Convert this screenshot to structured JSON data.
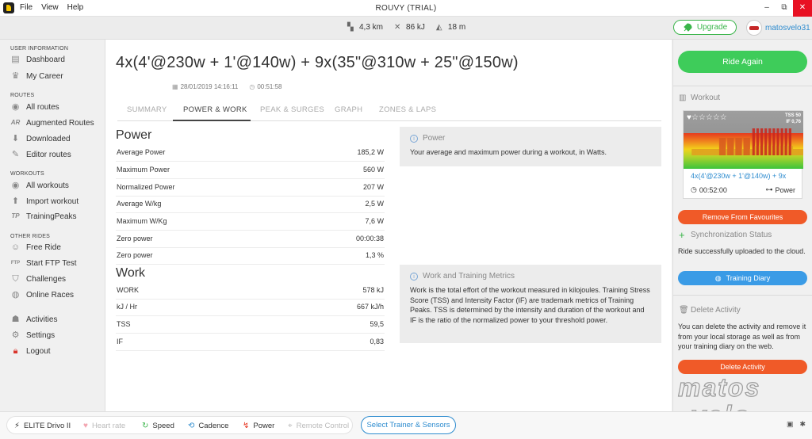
{
  "window": {
    "title": "ROUVY (TRIAL)",
    "menu": [
      "File",
      "View",
      "Help"
    ],
    "controls": {
      "minimize": "–",
      "maximize": "⧉",
      "close": "✕"
    }
  },
  "topbar": {
    "distance": "4,3 km",
    "energy": "86 kJ",
    "elevation": "18 m",
    "upgrade_label": "Upgrade",
    "username": "matosvelo31"
  },
  "sidebar": {
    "sections": [
      {
        "label": "USER INFORMATION",
        "items": [
          {
            "label": "Dashboard",
            "icon": "dashboard-icon"
          },
          {
            "label": "My Career",
            "icon": "trophy-icon"
          }
        ]
      },
      {
        "label": "ROUTES",
        "items": [
          {
            "label": "All routes",
            "icon": "eye-icon"
          },
          {
            "label": "Augmented Routes",
            "icon": "ar-icon"
          },
          {
            "label": "Downloaded",
            "icon": "download-icon"
          },
          {
            "label": "Editor routes",
            "icon": "pencil-icon"
          }
        ]
      },
      {
        "label": "WORKOUTS",
        "items": [
          {
            "label": "All workouts",
            "icon": "eye-icon"
          },
          {
            "label": "Import workout",
            "icon": "upload-icon"
          },
          {
            "label": "TrainingPeaks",
            "icon": "trainingpeaks-icon"
          }
        ]
      },
      {
        "label": "OTHER RIDES",
        "items": [
          {
            "label": "Free Ride",
            "icon": "smile-icon"
          },
          {
            "label": "Start FTP Test",
            "icon": "ftp-icon"
          },
          {
            "label": "Challenges",
            "icon": "shield-icon"
          },
          {
            "label": "Online Races",
            "icon": "globe-icon"
          }
        ]
      }
    ],
    "bottom": [
      {
        "label": "Activities",
        "icon": "people-icon"
      },
      {
        "label": "Settings",
        "icon": "gear-icon"
      },
      {
        "label": "Logout",
        "icon": "lock-icon"
      }
    ],
    "ar_glyph": "AR",
    "tp_glyph": "TP",
    "ftp_glyph": "FTP"
  },
  "workout": {
    "title": "4x(4'@230w + 1'@140w) + 9x(35\"@310w + 25\"@150w)",
    "date": "28/01/2019 14:16:11",
    "duration": "00:51:58"
  },
  "tabs": [
    "SUMMARY",
    "POWER & WORK",
    "PEAK & SURGES",
    "GRAPH",
    "ZONES & LAPS"
  ],
  "power": {
    "heading": "Power",
    "rows": [
      {
        "label": "Average Power",
        "value": "185,2 W"
      },
      {
        "label": "Maximum Power",
        "value": "560 W"
      },
      {
        "label": "Normalized Power",
        "value": "207 W"
      },
      {
        "label": "Average W/kg",
        "value": "2,5 W"
      },
      {
        "label": "Maximum W/Kg",
        "value": "7,6 W"
      },
      {
        "label": "Zero power",
        "value": "00:00:38"
      },
      {
        "label": "Zero power",
        "value": "1,3 %"
      }
    ],
    "info_title": "Power",
    "info_text": "Your average and maximum power during a workout, in Watts."
  },
  "work": {
    "heading": "Work",
    "rows": [
      {
        "label": "WORK",
        "value": "578 kJ"
      },
      {
        "label": "kJ / Hr",
        "value": "667 kJ/h"
      },
      {
        "label": "TSS",
        "value": "59,5"
      },
      {
        "label": "IF",
        "value": "0,83"
      }
    ],
    "info_title": "Work and Training Metrics",
    "info_text": "Work is the total effort of the workout measured in kilojoules. Training Stress Score (TSS) and Intensity Factor (IF) are trademark metrics of Training Peaks. TSS is determined by the intensity and duration of the workout and IF is the ratio of the normalized power to your threshold power."
  },
  "rpanel": {
    "ride_again": "Ride Again",
    "workout_heading": "Workout",
    "card": {
      "tss": "TSS 50",
      "if": "IF 0,76",
      "link": "4x(4'@230w + 1'@140w) + 9x",
      "duration": "00:52:00",
      "type": "Power",
      "stars_glyph": "♥☆☆☆☆☆",
      "profile": [
        0,
        0,
        0,
        0,
        0,
        0,
        0,
        0,
        0,
        0,
        0.2,
        0.2,
        0.2,
        0.2,
        0.2,
        0.2,
        0.2,
        0.2,
        0.2,
        0.2,
        0.2,
        0.2,
        0.2,
        0.2,
        0.2,
        0.2,
        0.2,
        0.2,
        0.2,
        0.2,
        0.2,
        0.2,
        0.2,
        0.2,
        0.2,
        0.2,
        0.2,
        0.2,
        0.2,
        0.2,
        0.2,
        0.2,
        0.2,
        0.2,
        0.55,
        0.55,
        0.55,
        0.55,
        0.55,
        0.55,
        0.55,
        0.55,
        0.2,
        0.2,
        0.55,
        0.55,
        0.55,
        0.55,
        0.55,
        0.55,
        0.55,
        0.55,
        0.2,
        0.2,
        0.55,
        0.55,
        0.55,
        0.55,
        0.55,
        0.55,
        0.55,
        0.55,
        0.2,
        0.2,
        0.55,
        0.55,
        0.55,
        0.55,
        0.55,
        0.55,
        0.55,
        0.55,
        0.2,
        0.2,
        0.2,
        0.85,
        0.85,
        0.85,
        0.3,
        0.3,
        0.85,
        0.85,
        0.85,
        0.3,
        0.3,
        0.85,
        0.85,
        0.85,
        0.3,
        0.3,
        0.85,
        0.85,
        0.85,
        0.3,
        0.3,
        0.85,
        0.85,
        0.85,
        0.3,
        0.3,
        0.85,
        0.85,
        0.85,
        0.3,
        0.3,
        0.85,
        0.85,
        0.85,
        0.3,
        0.3,
        0.85,
        0.85,
        0.85,
        0.3,
        0.3,
        0.85,
        0.85,
        0.85,
        0.3,
        0.3,
        0.85,
        0.85,
        0.85,
        0.3,
        0.3,
        0.2,
        0.2,
        0.2,
        0.2,
        0.2,
        0.2,
        0.2,
        0.2,
        0.2,
        0.2,
        0.2,
        0.2,
        0.2
      ]
    },
    "remove_fav": "Remove From Favourites",
    "sync_heading": "Synchronization Status",
    "sync_text": "Ride successfully uploaded to the cloud.",
    "training_diary": "Training Diary",
    "delete_heading": "Delete Activity",
    "delete_text": "You can delete the activity and remove it from your local storage as well as from your training diary on the web.",
    "delete_btn": "Delete Activity"
  },
  "watermark": {
    "text": "matos velo"
  },
  "statusbar": {
    "items": [
      {
        "label": "ELITE Drivo II",
        "icon": "trainer-icon",
        "active": true
      },
      {
        "label": "Heart rate",
        "icon": "heart-icon",
        "active": false
      },
      {
        "label": "Speed",
        "icon": "speed-icon",
        "active": true
      },
      {
        "label": "Cadence",
        "icon": "cadence-icon",
        "active": true
      },
      {
        "label": "Power",
        "icon": "power-icon",
        "active": true
      },
      {
        "label": "Remote Control",
        "icon": "remote-icon",
        "active": false
      }
    ],
    "select_btn": "Select Trainer & Sensors"
  },
  "colors": {
    "accent_blue": "#2e8ccf",
    "green": "#3ecc5a",
    "orange": "#f05a28",
    "light_blue": "#3a9be6",
    "red_icon": "#d9342b"
  }
}
